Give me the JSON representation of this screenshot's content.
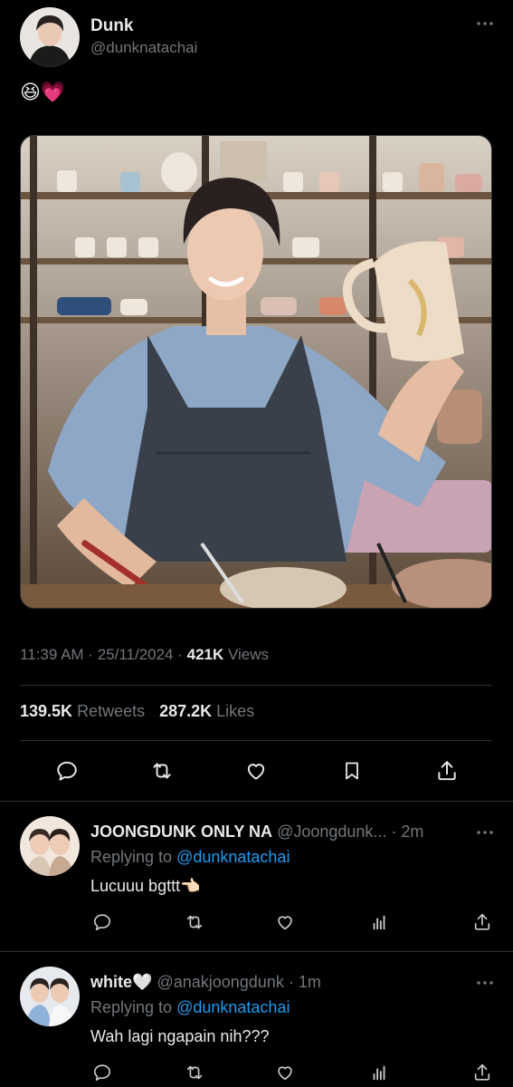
{
  "tweet": {
    "author_name": "Dunk",
    "author_handle": "@dunknatachai",
    "text": "😆💗",
    "time": "11:39 AM",
    "date": "25/11/2024",
    "views_count": "421K",
    "views_label": "Views",
    "retweets_count": "139.5K",
    "retweets_label": "Retweets",
    "likes_count": "287.2K",
    "likes_label": "Likes",
    "icons": [
      "more-icon",
      "reply-icon",
      "retweet-icon",
      "like-icon",
      "bookmark-icon",
      "share-icon"
    ]
  },
  "replies": [
    {
      "name": "JOONGDUNK ONLY NA",
      "handle": "@Joongdunk...",
      "time": "2m",
      "replying_prefix": "Replying to",
      "replying_to": "@dunknatachai",
      "text": "Lucuuu bgttt👈🏻"
    },
    {
      "name": "white🤍",
      "handle": "@anakjoongdunk",
      "time": "1m",
      "replying_prefix": "Replying to",
      "replying_to": "@dunknatachai",
      "text": "Wah lagi ngapain nih???"
    }
  ],
  "colors": {
    "background": "#000000",
    "text_primary": "#e7e9ea",
    "text_secondary": "#71767b",
    "link": "#1d9bf0",
    "divider": "#2f3336"
  }
}
